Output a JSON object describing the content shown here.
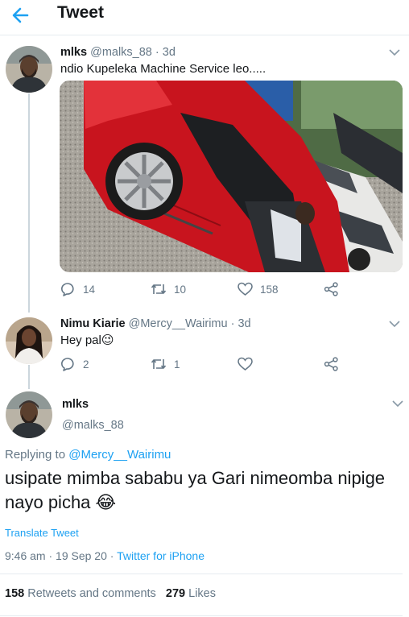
{
  "header": {
    "title": "Tweet",
    "back_icon": "arrow-left-icon"
  },
  "colors": {
    "accent": "#1da1f2",
    "secondary_text": "#657786",
    "primary_text": "#14171a",
    "divider": "#e6ecf0"
  },
  "tweet1": {
    "name": "mlks",
    "handle": "@malks_88",
    "time": "· 3d",
    "text": "ndio Kupeleka Machine Service leo.....",
    "replies": "14",
    "retweets": "10",
    "likes": "158"
  },
  "tweet2": {
    "name": "Nimu Kiarie",
    "badge": "",
    "handle": "@Mercy__Wairimu",
    "time": "· 3d",
    "text": "Hey pal",
    "emoji": "😉",
    "replies": "2",
    "retweets": "1",
    "likes": ""
  },
  "main_tweet": {
    "name": "mlks",
    "handle": "@malks_88",
    "replying_prefix": "Replying to ",
    "replying_to": "@Mercy__Wairimu",
    "text": "usipate mimba sababu ya Gari nimeomba nipige nayo picha",
    "emoji": "😂",
    "translate": "Translate Tweet",
    "time": "9:46 am · 19 Sep 20 · ",
    "source": "Twitter for iPhone",
    "retweets_count": "158",
    "retweets_label": "Retweets and comments",
    "likes_count": "279",
    "likes_label": "Likes"
  }
}
